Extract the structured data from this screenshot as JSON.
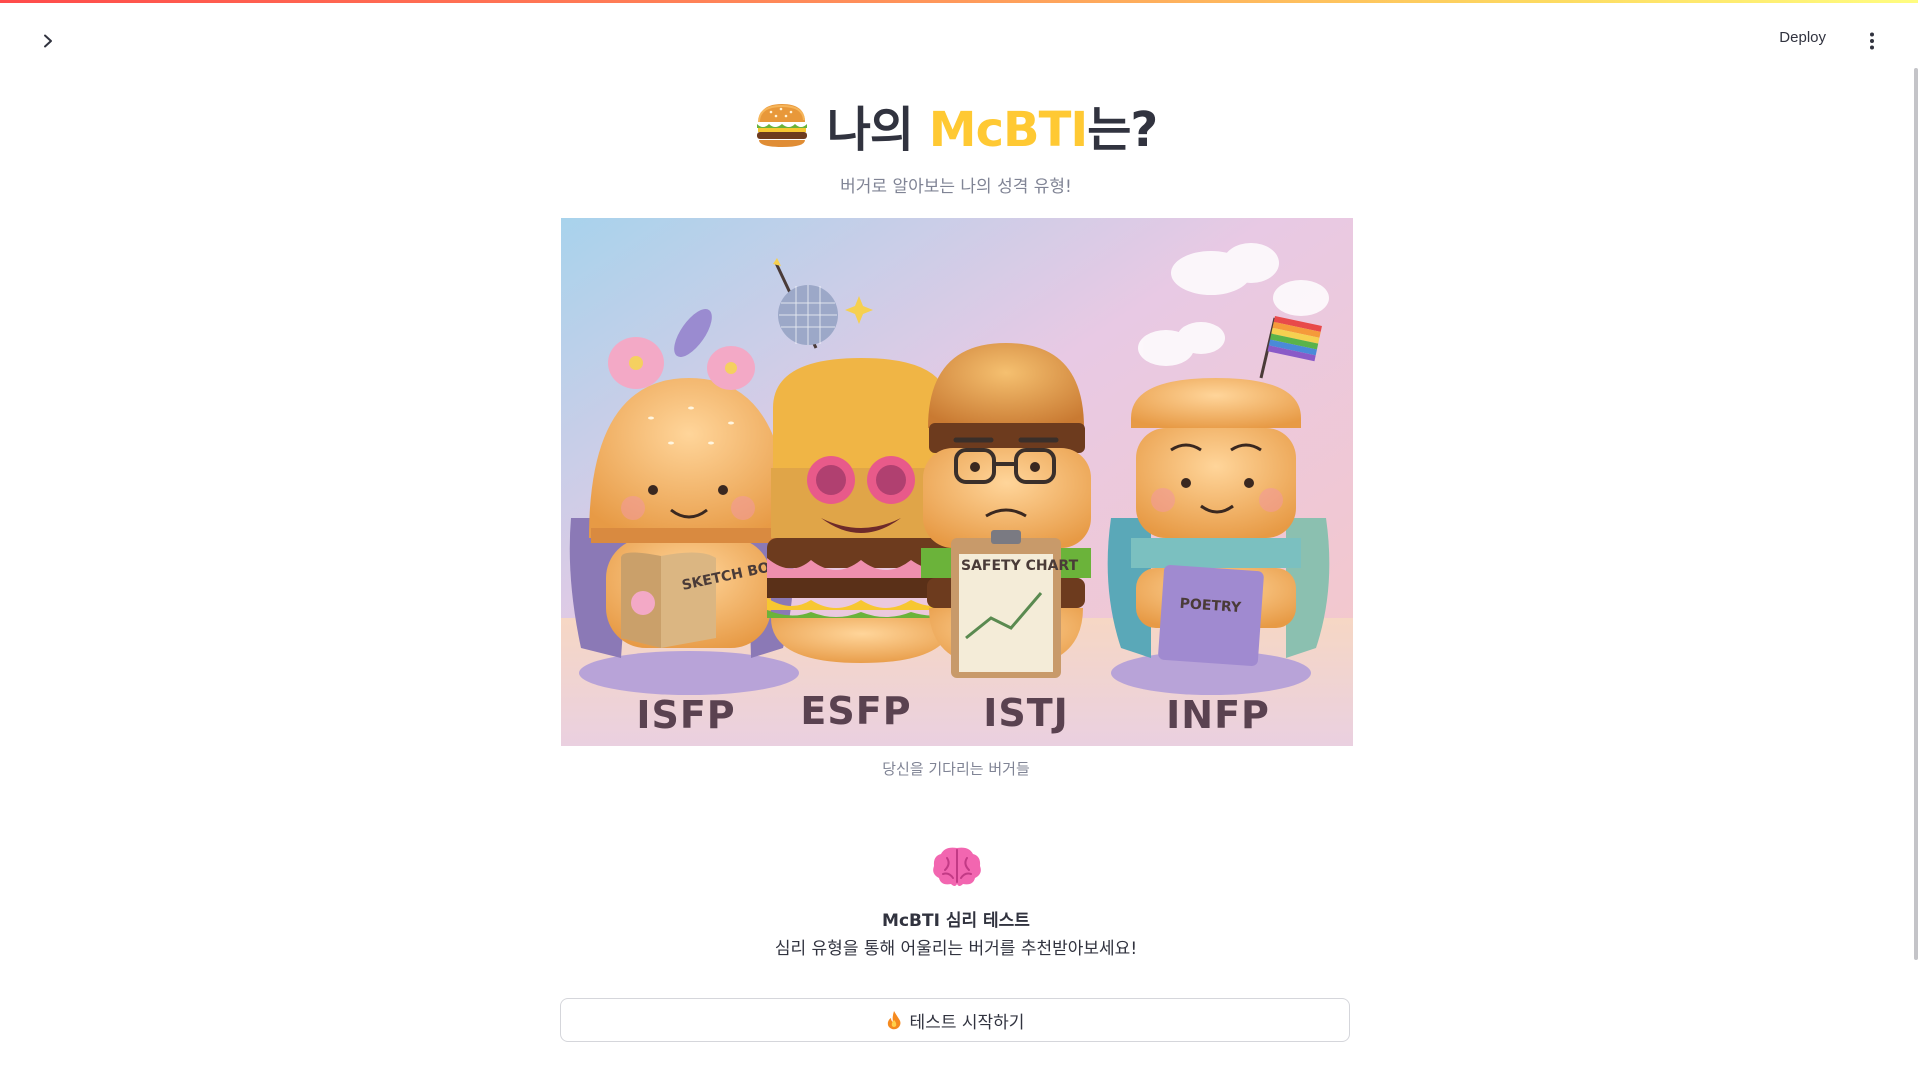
{
  "header": {
    "deploy_label": "Deploy"
  },
  "title": {
    "prefix": "나의 ",
    "accent": "McBTI",
    "suffix": "는?"
  },
  "subtitle": "버거로 알아보는 나의 성격 유형!",
  "hero": {
    "caption": "당신을 기다리는 버거들",
    "types": [
      "ISFP",
      "ESFP",
      "ISTJ",
      "INFP"
    ],
    "book_labels": {
      "sketch": "SKETCH BOOK",
      "chart": "SAFETY CHART",
      "poetry": "POETRY"
    }
  },
  "card": {
    "title": "McBTI 심리 테스트",
    "description": "심리 유형을 통해 어울리는 버거를 추천받아보세요!"
  },
  "start_button": {
    "label": "테스트 시작하기"
  },
  "icons": {
    "sidebar": "chevron-right-icon",
    "menu": "kebab-menu-icon",
    "title": "burger-icon",
    "card": "brain-icon",
    "button": "fire-icon"
  },
  "colors": {
    "accent": "#ffc933",
    "text": "#31333f",
    "muted": "#808495"
  }
}
